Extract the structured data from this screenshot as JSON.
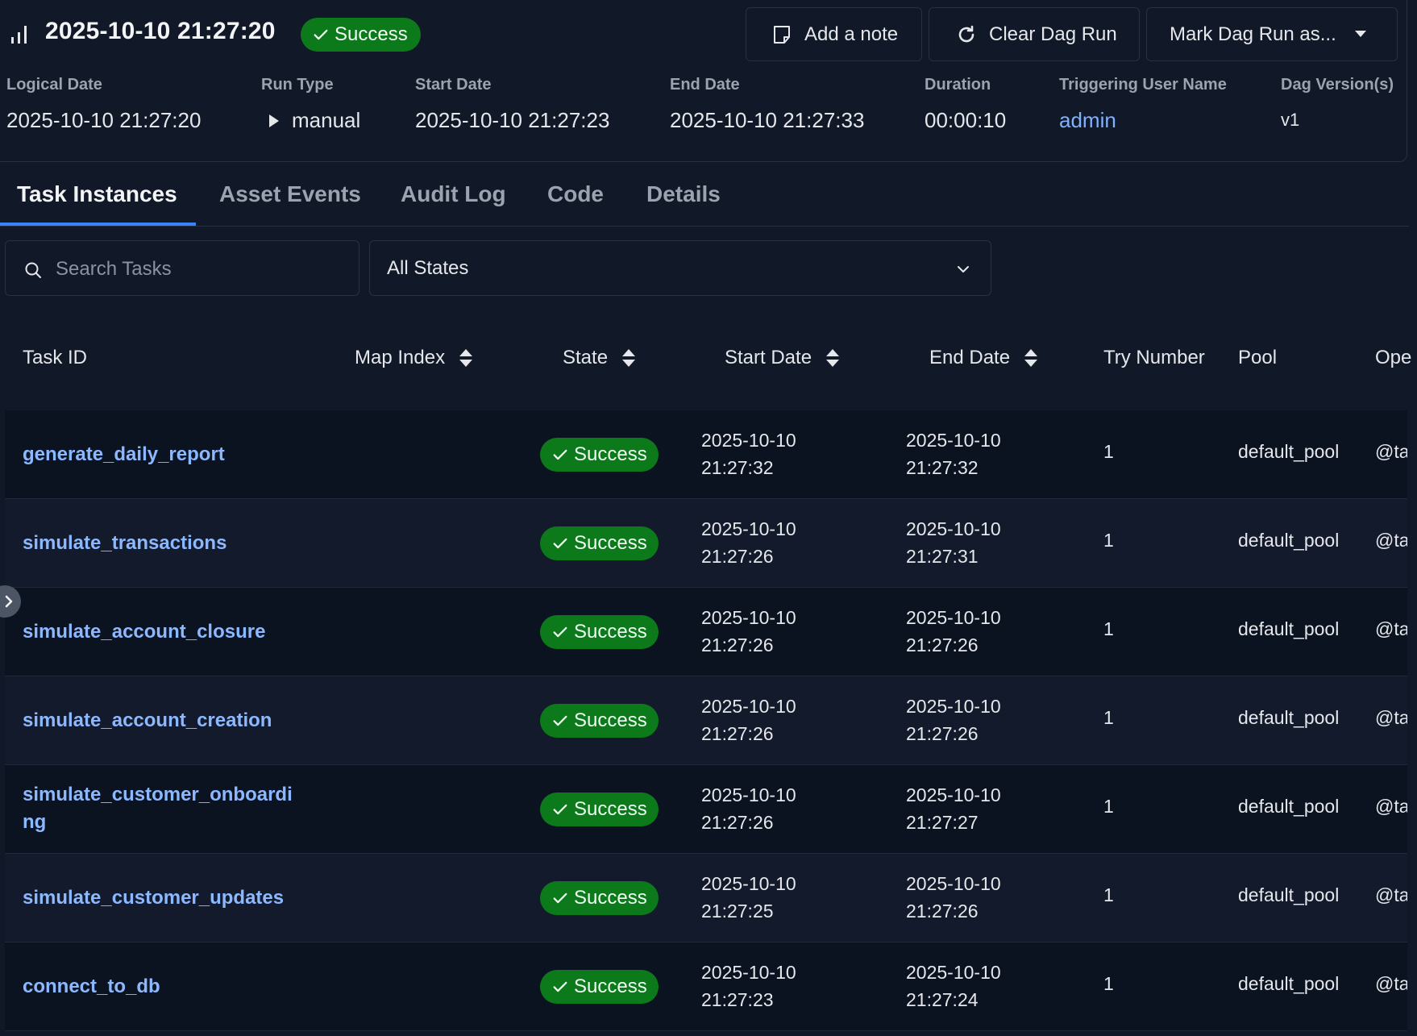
{
  "header": {
    "run_title": "2025-10-10 21:27:20",
    "state_badge": "Success",
    "buttons": {
      "add_note": "Add a note",
      "clear_dag_run": "Clear Dag Run",
      "mark_dag_run": "Mark Dag Run as..."
    },
    "meta": {
      "logical_date": {
        "label": "Logical Date",
        "value": "2025-10-10 21:27:20"
      },
      "run_type": {
        "label": "Run Type",
        "value": "manual"
      },
      "start_date": {
        "label": "Start Date",
        "value": "2025-10-10 21:27:23"
      },
      "end_date": {
        "label": "End Date",
        "value": "2025-10-10 21:27:33"
      },
      "duration": {
        "label": "Duration",
        "value": "00:00:10"
      },
      "triggering_user": {
        "label": "Triggering User Name",
        "value": "admin"
      },
      "dag_versions": {
        "label": "Dag Version(s)",
        "value": "v1"
      }
    }
  },
  "tabs": [
    "Task Instances",
    "Asset Events",
    "Audit Log",
    "Code",
    "Details"
  ],
  "filters": {
    "search_placeholder": "Search Tasks",
    "state_selected": "All States"
  },
  "table": {
    "columns": [
      "Task ID",
      "Map Index",
      "State",
      "Start Date",
      "End Date",
      "Try Number",
      "Pool",
      "Ope"
    ],
    "rows": [
      {
        "task_id": "generate_daily_report",
        "state": "Success",
        "start_date": "2025-10-10\n21:27:32",
        "end_date": "2025-10-10\n21:27:32",
        "try_number": "1",
        "pool": "default_pool",
        "operator": "@ta"
      },
      {
        "task_id": "simulate_transactions",
        "state": "Success",
        "start_date": "2025-10-10\n21:27:26",
        "end_date": "2025-10-10\n21:27:31",
        "try_number": "1",
        "pool": "default_pool",
        "operator": "@ta"
      },
      {
        "task_id": "simulate_account_closure",
        "state": "Success",
        "start_date": "2025-10-10\n21:27:26",
        "end_date": "2025-10-10\n21:27:26",
        "try_number": "1",
        "pool": "default_pool",
        "operator": "@ta"
      },
      {
        "task_id": "simulate_account_creation",
        "state": "Success",
        "start_date": "2025-10-10\n21:27:26",
        "end_date": "2025-10-10\n21:27:26",
        "try_number": "1",
        "pool": "default_pool",
        "operator": "@ta"
      },
      {
        "task_id": "simulate_customer_onboarding",
        "state": "Success",
        "start_date": "2025-10-10\n21:27:26",
        "end_date": "2025-10-10\n21:27:27",
        "try_number": "1",
        "pool": "default_pool",
        "operator": "@ta"
      },
      {
        "task_id": "simulate_customer_updates",
        "state": "Success",
        "start_date": "2025-10-10\n21:27:25",
        "end_date": "2025-10-10\n21:27:26",
        "try_number": "1",
        "pool": "default_pool",
        "operator": "@ta"
      },
      {
        "task_id": "connect_to_db",
        "state": "Success",
        "start_date": "2025-10-10\n21:27:23",
        "end_date": "2025-10-10\n21:27:24",
        "try_number": "1",
        "pool": "default_pool",
        "operator": "@ta"
      }
    ]
  },
  "colors": {
    "background": "#111827",
    "success": "#0c7a1a",
    "link": "#8cb8ff",
    "accent": "#3b82f6"
  }
}
